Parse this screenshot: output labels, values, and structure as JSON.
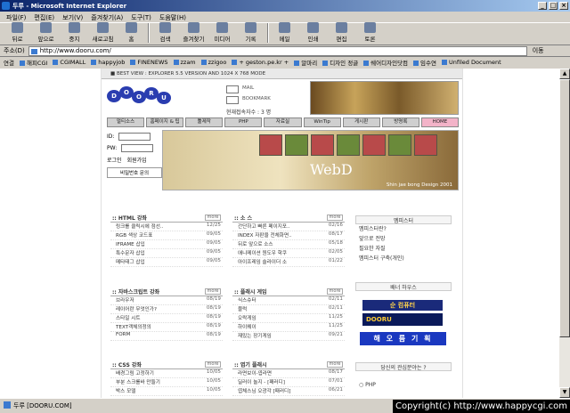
{
  "window": {
    "title": "두루 - Microsoft Internet Explorer"
  },
  "menu": [
    "파일(F)",
    "편집(E)",
    "보기(V)",
    "즐겨찾기(A)",
    "도구(T)",
    "도움말(H)"
  ],
  "toolbar": [
    {
      "label": "뒤로",
      "icon": "back-arrow"
    },
    {
      "label": "앞으로",
      "icon": "forward-arrow"
    },
    {
      "label": "중지",
      "icon": "stop-icon"
    },
    {
      "label": "새로고침",
      "icon": "refresh-icon"
    },
    {
      "label": "홈",
      "icon": "home-icon"
    },
    {
      "label": "검색",
      "icon": "search-icon"
    },
    {
      "label": "즐겨찾기",
      "icon": "favorites-icon"
    },
    {
      "label": "미디어",
      "icon": "media-icon"
    },
    {
      "label": "기록",
      "icon": "history-icon"
    },
    {
      "label": "메일",
      "icon": "mail-icon"
    },
    {
      "label": "인쇄",
      "icon": "print-icon"
    },
    {
      "label": "편집",
      "icon": "edit-icon"
    },
    {
      "label": "토론",
      "icon": "discuss-icon"
    }
  ],
  "address": {
    "label": "주소(D)",
    "url": "http://www.dooru.com/",
    "go": "이동"
  },
  "links": {
    "label": "연결",
    "items": [
      "해피CGI",
      "CGIMALL",
      "happyjob",
      "FINENEWS",
      "zzam",
      "zzigoo",
      "+ geston.pe.kr +",
      "알마리",
      "디자인 정글",
      "쉐어디자인닷컴",
      "임수연",
      "Unfiled Document"
    ]
  },
  "site": {
    "topbar": "■ BEST VIEW : EXPLORER 5.5 VERSION AND 1024 X 768 MODE",
    "logo": [
      "D",
      "O",
      "O",
      "R",
      "U"
    ],
    "mail": "MAIL",
    "bookmark": "BOOKMARK",
    "visitors": "현재접속자수 : 3 명",
    "nav": [
      "멀티소스",
      "홈페이지 & 팁",
      "툴제작",
      "PHP",
      "자료실",
      "WinTip",
      "게시판",
      "방명록",
      "HOME"
    ],
    "login": {
      "id": "ID:",
      "pw": "PW:",
      "login_btn": "로그인",
      "join_btn": "회원가입",
      "find_btn": "비밀번호 문의"
    },
    "banner": {
      "title": "WebD",
      "sig": "Shin jae bong Design 2001"
    },
    "more": "more",
    "sections": [
      {
        "title": "HTML 강좌",
        "items": [
          [
            "링크를 클릭시에 점선..",
            "12/25"
          ],
          [
            "RGB 색상 코드표",
            "09/05"
          ],
          [
            "IFRAME 삽입",
            "09/05"
          ],
          [
            "특수문자 삽입",
            "09/05"
          ],
          [
            "메타태그 삽입",
            "09/05"
          ]
        ]
      },
      {
        "title": "소 스",
        "items": [
          [
            "간단하고 빠른 페이지포..",
            "02/16"
          ],
          [
            "INDEX 자판을 전체화면..",
            "08/17"
          ],
          [
            "뒤로 앞으로 소스",
            "05/18"
          ],
          [
            "애니메이션 원도우 학쿠",
            "02/05"
          ],
          [
            "아이프레임 슬라이더 소",
            "01/22"
          ]
        ]
      },
      {
        "title": "자바스크립트 강좌",
        "items": [
          [
            "브라우저",
            "08/19"
          ],
          [
            "레이어란 무엇인가?",
            "08/19"
          ],
          [
            "스타일 시트",
            "08/19"
          ],
          [
            "TEXT객체의정의",
            "08/19"
          ],
          [
            "FORM",
            "08/19"
          ]
        ]
      },
      {
        "title": "플래시 게임",
        "items": [
          [
            "식스슈터",
            "02/11"
          ],
          [
            "블럭",
            "02/11"
          ],
          [
            "오락게임",
            "11/25"
          ],
          [
            "하이웨이",
            "11/25"
          ],
          [
            "재밌는 장기게임",
            "09/21"
          ]
        ]
      },
      {
        "title": "CSS 강좌",
        "items": [
          [
            "배경그림 고정하기",
            "10/05"
          ],
          [
            "부분 스크롤바 만들기",
            "10/05"
          ],
          [
            "박스 모델",
            "10/05"
          ]
        ]
      },
      {
        "title": "엽기 플래시",
        "items": [
          [
            "라면보이-엽라면",
            "08/17"
          ],
          [
            "딜러이 놀지 - [패러디]",
            "07/01"
          ],
          [
            "엽체스님 오광각 [패러디]",
            "06/21"
          ]
        ]
      }
    ],
    "right": {
      "title": "멤피스터",
      "items": [
        "멤피스터란?",
        "앞으로 전망",
        "필요한 자질",
        "멤피스터 구축(개인)"
      ],
      "houses": "배너 하우스",
      "ban1": "순 컴퓨터",
      "ban2": "DOORU",
      "ban3": "해 오 름 기 획",
      "poll": "당신의 관심분야는 ?",
      "poll_opt": "PHP"
    }
  },
  "status": {
    "text": "두루 [DOORU.COM]",
    "copyright": "Copyright(c) http://www.happycgi.com"
  }
}
